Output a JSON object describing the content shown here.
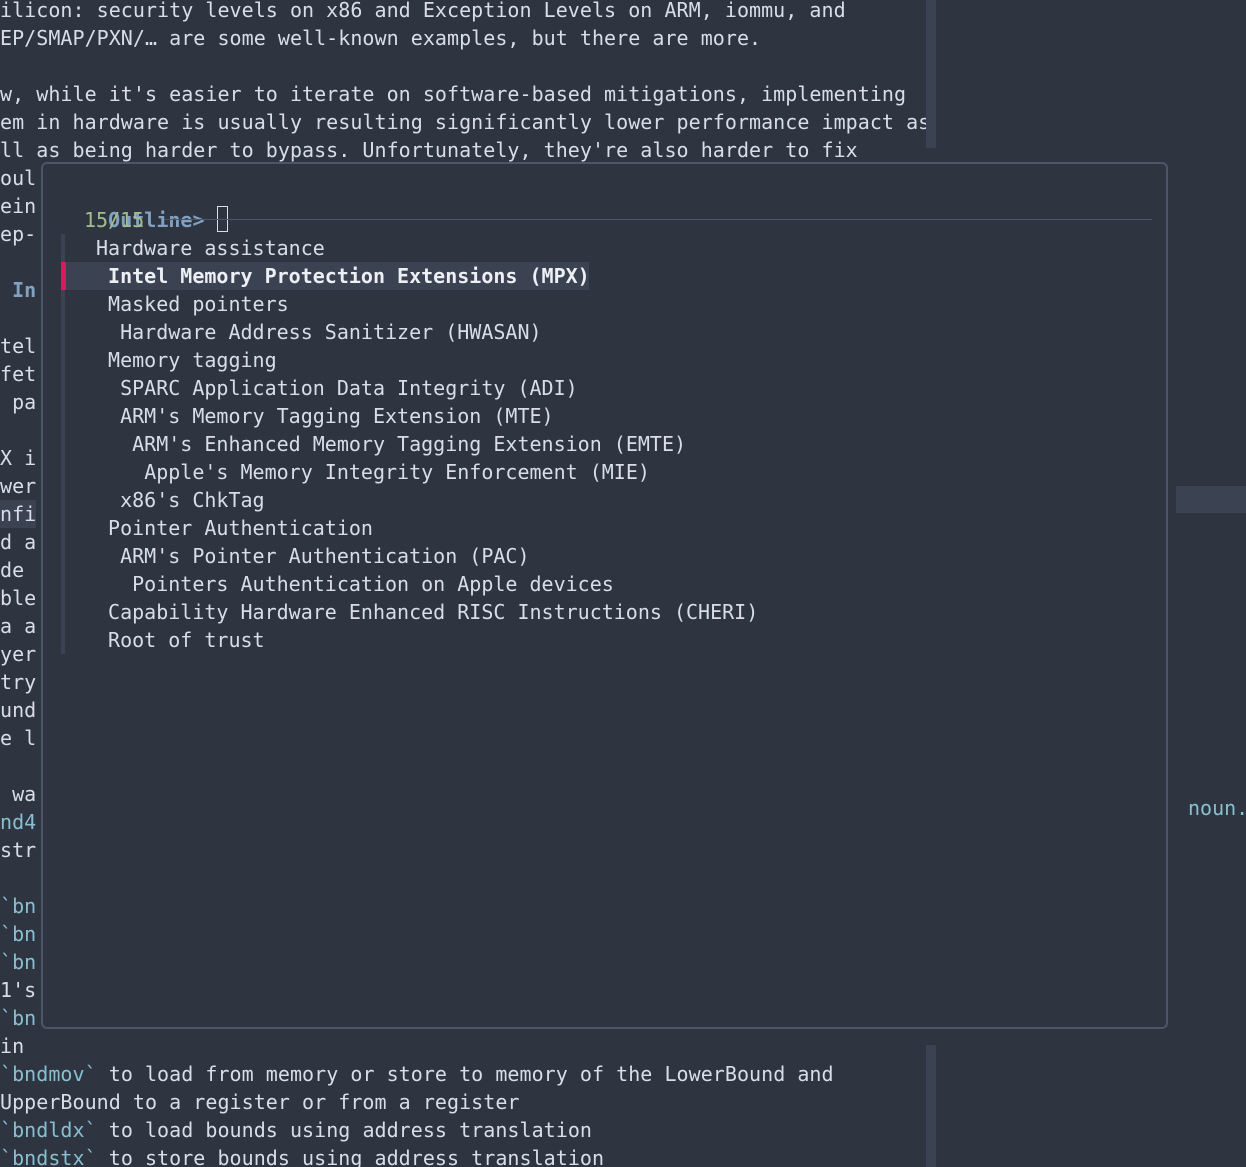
{
  "document": {
    "lines_top": [
      "ilicon: security levels on x86 and Exception Levels on ARM, iommu, and",
      "EP/SMAP/PXN/… are some well-known examples, but there are more.",
      "",
      "w, while it's easier to iterate on software-based mitigations, implementing",
      "em in hardware is usually resulting significantly lower performance impact as",
      "ll as being harder to bypass. Unfortunately, they're also harder to fix",
      "oul"
    ],
    "left_fragments": [
      {
        "text": "ein",
        "style": ""
      },
      {
        "text": "ep-",
        "style": ""
      },
      {
        "text": "",
        "style": ""
      },
      {
        "text": " In",
        "style": "bold-blue"
      },
      {
        "text": "",
        "style": ""
      },
      {
        "text": "tel",
        "style": ""
      },
      {
        "text": "fet",
        "style": ""
      },
      {
        "text": " pa",
        "style": ""
      },
      {
        "text": "",
        "style": ""
      },
      {
        "text": "X i",
        "style": ""
      },
      {
        "text": "wer",
        "style": ""
      },
      {
        "text": "nfi",
        "style": "hl"
      },
      {
        "text": "d a",
        "style": ""
      },
      {
        "text": "de ",
        "style": ""
      },
      {
        "text": "ble",
        "style": ""
      },
      {
        "text": "a a",
        "style": ""
      },
      {
        "text": "yer",
        "style": ""
      },
      {
        "text": "try",
        "style": ""
      },
      {
        "text": "und",
        "style": ""
      },
      {
        "text": "e l",
        "style": ""
      },
      {
        "text": "",
        "style": ""
      },
      {
        "text": " wa",
        "style": ""
      },
      {
        "text": "nd4",
        "style": "teal"
      },
      {
        "text": "str",
        "style": ""
      },
      {
        "text": "",
        "style": ""
      },
      {
        "text": "`bn",
        "style": "teal"
      },
      {
        "text": "`bn",
        "style": "teal"
      },
      {
        "text": "`bn",
        "style": "teal"
      },
      {
        "text": "1's",
        "style": ""
      },
      {
        "text": "`bn",
        "style": "teal"
      },
      {
        "text": "in ",
        "style": ""
      }
    ],
    "lines_bottom": [
      {
        "code": "`bndmov`",
        "rest": " to load from memory or store to memory of the LowerBound and"
      },
      {
        "code": "",
        "rest": "UpperBound to a register or from a register"
      },
      {
        "code": "`bndldx`",
        "rest": " to load bounds using address translation"
      },
      {
        "code": "`bndstx`",
        "rest": " to store bounds using address translation"
      }
    ],
    "right_fragment": "noun."
  },
  "outline": {
    "prompt_label": "Outline>",
    "query": "",
    "count": "15/15",
    "selected_index": 1,
    "items": [
      {
        "label": "Hardware assistance",
        "depth": 0
      },
      {
        "label": "Intel Memory Protection Extensions (MPX)",
        "depth": 1
      },
      {
        "label": "Masked pointers",
        "depth": 1
      },
      {
        "label": "Hardware Address Sanitizer (HWASAN)",
        "depth": 2
      },
      {
        "label": "Memory tagging",
        "depth": 1
      },
      {
        "label": "SPARC Application Data Integrity (ADI)",
        "depth": 2
      },
      {
        "label": "ARM's Memory Tagging Extension (MTE)",
        "depth": 2
      },
      {
        "label": "ARM's Enhanced Memory Tagging Extension (EMTE)",
        "depth": 3
      },
      {
        "label": "Apple's Memory Integrity Enforcement (MIE)",
        "depth": 4
      },
      {
        "label": "x86's ChkTag",
        "depth": 2
      },
      {
        "label": "Pointer Authentication",
        "depth": 1
      },
      {
        "label": "ARM's Pointer Authentication (PAC)",
        "depth": 2
      },
      {
        "label": "Pointers Authentication on Apple devices",
        "depth": 3
      },
      {
        "label": "Capability Hardware Enhanced RISC Instructions (CHERI)",
        "depth": 1
      },
      {
        "label": "Root of trust",
        "depth": 1
      }
    ]
  },
  "colors": {
    "background": "#2e3440",
    "foreground": "#d8dee9",
    "accent": "#81a1c1",
    "code": "#88c0d0",
    "count": "#a3be8c",
    "selection_marker": "#d81b60",
    "popup_border": "#4c566a"
  }
}
